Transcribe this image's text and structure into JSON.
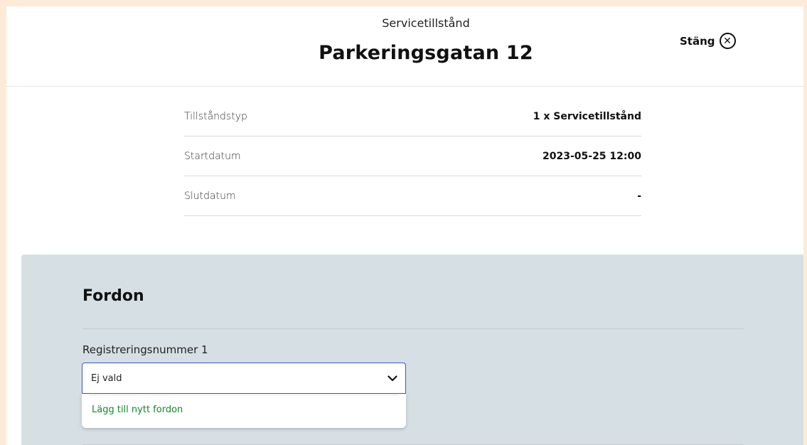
{
  "header": {
    "subtitle": "Servicetillstånd",
    "title": "Parkeringsgatan 12",
    "close_label": "Stäng"
  },
  "details": [
    {
      "label": "Tillståndstyp",
      "value": "1 x Servicetillstånd"
    },
    {
      "label": "Startdatum",
      "value": "2023-05-25 12:00"
    },
    {
      "label": "Slutdatum",
      "value": "-"
    }
  ],
  "vehicle": {
    "heading": "Fordon",
    "field_label": "Registreringsnummer 1",
    "selected_value": "Ej vald",
    "options": [
      "Lägg till nytt fordon"
    ]
  },
  "icons": {
    "close": "close-icon",
    "dropdown": "chevron-down-icon"
  },
  "colors": {
    "page_background": "#fdebd7",
    "panel_background": "#d6dfe4",
    "select_border": "#3b56c4",
    "option_text": "#118a2e"
  }
}
